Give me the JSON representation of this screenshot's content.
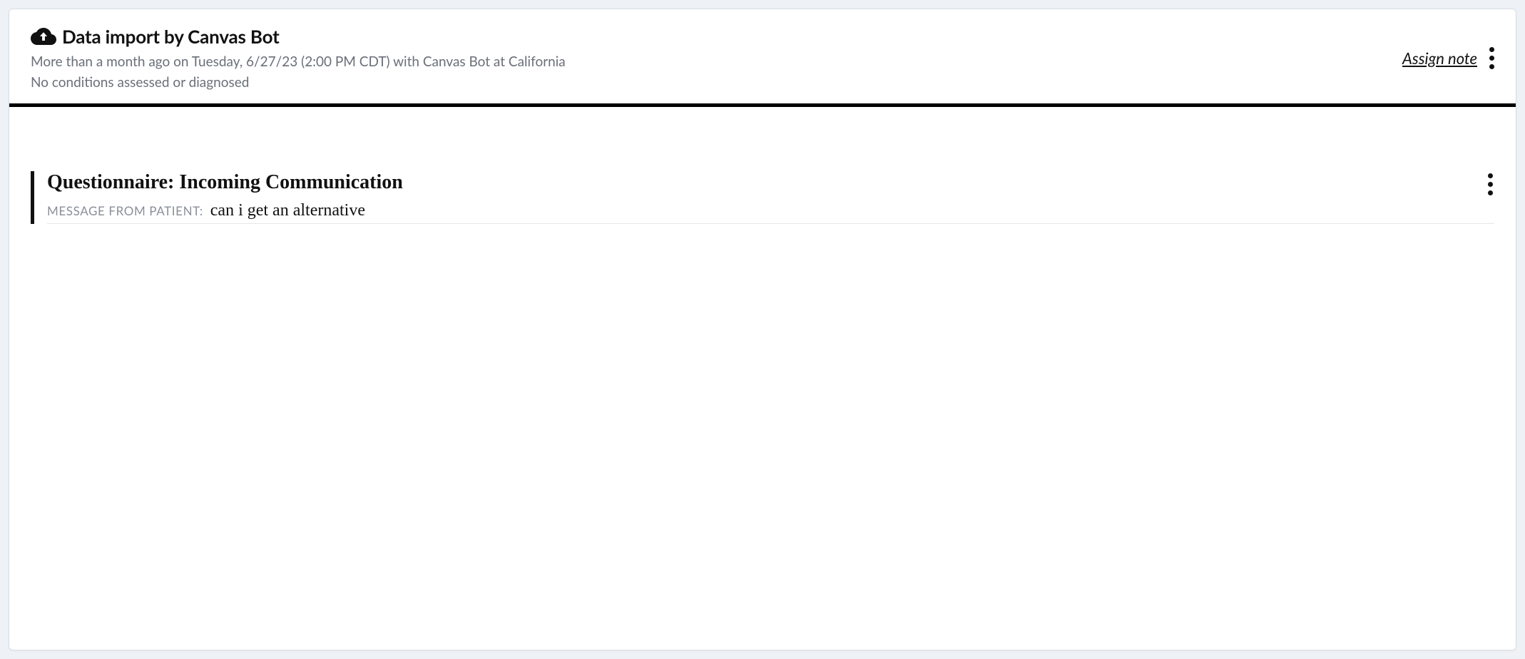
{
  "header": {
    "title": "Data import by Canvas Bot",
    "subtitle": "More than a month ago on Tuesday, 6/27/23 (2:00 PM CDT) with Canvas Bot at California",
    "conditions": "No conditions assessed or diagnosed",
    "assign_link": "Assign note"
  },
  "entry": {
    "title": "Questionnaire: Incoming Communication",
    "message_label": "MESSAGE FROM PATIENT:",
    "message_value": "can i get an alternative"
  }
}
